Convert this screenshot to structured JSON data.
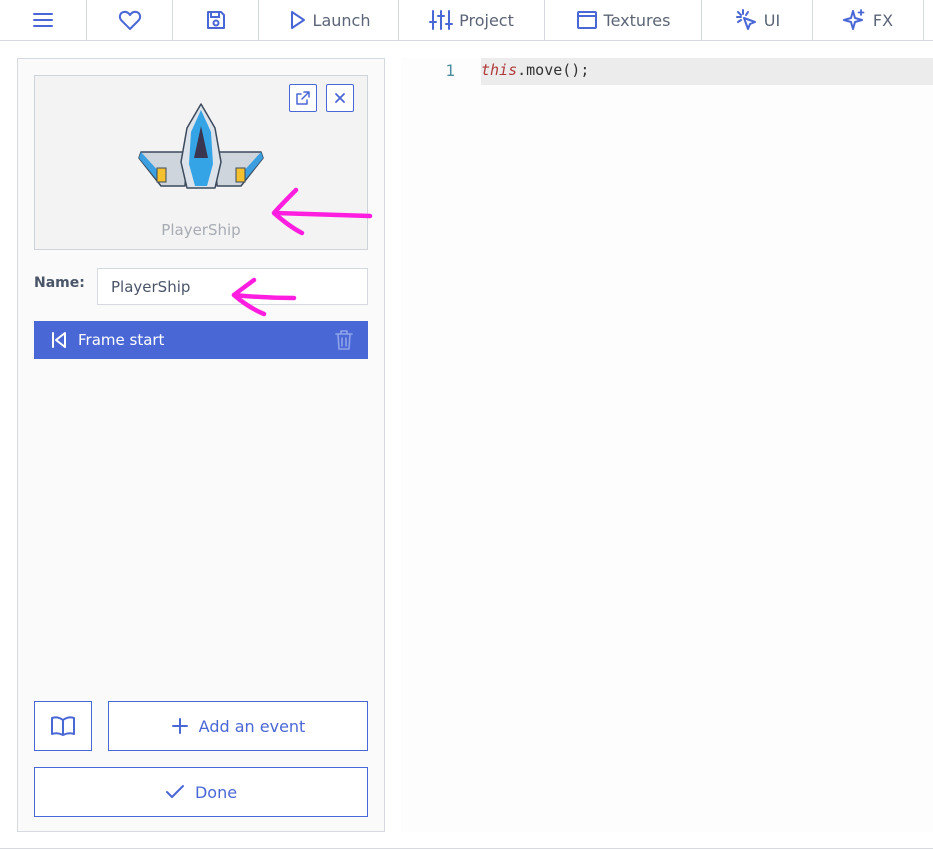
{
  "toolbar": {
    "launch": "Launch",
    "project": "Project",
    "textures": "Textures",
    "ui": "UI",
    "fx": "FX",
    "icons": [
      "menu-icon",
      "heart-icon",
      "save-icon",
      "play-icon",
      "sliders-icon",
      "textures-icon",
      "ui-icon",
      "sparkles-icon"
    ]
  },
  "panel": {
    "preview_caption": "PlayerShip",
    "name_label": "Name:",
    "name_value": "PlayerShip",
    "event_label": "Frame start",
    "add_event_label": "Add an event",
    "done_label": "Done"
  },
  "editor": {
    "line_number": "1",
    "code_keyword": "this",
    "code_rest": ".move();"
  },
  "colors": {
    "accent": "#4a67d6",
    "annotation": "#ff1ee0"
  }
}
